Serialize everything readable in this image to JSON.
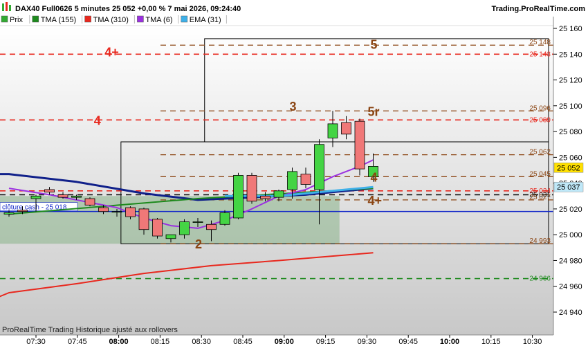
{
  "header": {
    "title": "DAX40 Full0626 5 minutes 25 052 +0,00 % 7 mai 2026, 09:24:40",
    "brand": "Trading.ProRealTime.com"
  },
  "legend": [
    {
      "label": "Prix",
      "color": "#33aa33"
    },
    {
      "label": "TMA (155)",
      "color": "#1d8a1d"
    },
    {
      "label": "TMA (310)",
      "color": "#e8281e"
    },
    {
      "label": "TMA (6)",
      "color": "#9b30e0"
    },
    {
      "label": "EMA (31)",
      "color": "#3fb0e8"
    }
  ],
  "footer": {
    "note": "ProRealTime Trading  Historique ajusté aux rollovers"
  },
  "cash_close": {
    "label": "clôture cash -  25 018",
    "value": 25018,
    "color": "#1428c8"
  },
  "colors": {
    "up": "#44d444",
    "down": "#f07878",
    "red_level": "#e8281e",
    "brown_level": "#8b4513",
    "green_level": "#1d8a1d"
  },
  "chart_data": {
    "type": "candlestick",
    "x_ticks": [
      "07:30",
      "07:45",
      "08:00",
      "08:15",
      "08:30",
      "08:45",
      "09:00",
      "09:15",
      "09:30",
      "09:45",
      "10:00",
      "10:15",
      "10:30"
    ],
    "bold_ticks": [
      "08:00",
      "09:00",
      "10:00"
    ],
    "y_ticks": [
      25160,
      25140,
      25120,
      25100,
      25080,
      25060,
      25040,
      25020,
      25000,
      24980,
      24960,
      24940
    ],
    "ylim": [
      24933,
      25166
    ],
    "candles": [
      {
        "o": 25016,
        "h": 25019,
        "l": 25014,
        "c": 25017
      },
      {
        "o": 25019,
        "h": 25022,
        "l": 25016,
        "c": 25018
      },
      {
        "o": 25028,
        "h": 25031,
        "l": 25018,
        "c": 25030
      },
      {
        "o": 25035,
        "h": 25037,
        "l": 25031,
        "c": 25033
      },
      {
        "o": 25031,
        "h": 25033,
        "l": 25028,
        "c": 25029
      },
      {
        "o": 25029,
        "h": 25031,
        "l": 25027,
        "c": 25030
      },
      {
        "o": 25028,
        "h": 25029,
        "l": 25022,
        "c": 25023
      },
      {
        "o": 25021,
        "h": 25023,
        "l": 25016,
        "c": 25018
      },
      {
        "o": 25018,
        "h": 25020,
        "l": 25014,
        "c": 25018
      },
      {
        "o": 25021,
        "h": 25022,
        "l": 25012,
        "c": 25014
      },
      {
        "o": 25020,
        "h": 25021,
        "l": 25000,
        "c": 25004
      },
      {
        "o": 25012,
        "h": 25013,
        "l": 24997,
        "c": 24999
      },
      {
        "o": 24997,
        "h": 25000,
        "l": 24994,
        "c": 25000
      },
      {
        "o": 25000,
        "h": 25012,
        "l": 24997,
        "c": 25010
      },
      {
        "o": 25010,
        "h": 25013,
        "l": 25006,
        "c": 25010
      },
      {
        "o": 25008,
        "h": 25011,
        "l": 24995,
        "c": 25004
      },
      {
        "o": 25008,
        "h": 25019,
        "l": 25007,
        "c": 25017
      },
      {
        "o": 25013,
        "h": 25048,
        "l": 25012,
        "c": 25046
      },
      {
        "o": 25046,
        "h": 25048,
        "l": 25024,
        "c": 25026
      },
      {
        "o": 25030,
        "h": 25033,
        "l": 25026,
        "c": 25028
      },
      {
        "o": 25029,
        "h": 25035,
        "l": 25026,
        "c": 25034
      },
      {
        "o": 25035,
        "h": 25052,
        "l": 25028,
        "c": 25049
      },
      {
        "o": 25047,
        "h": 25052,
        "l": 25036,
        "c": 25039
      },
      {
        "o": 25035,
        "h": 25074,
        "l": 25008,
        "c": 25070
      },
      {
        "o": 25075,
        "h": 25096,
        "l": 25068,
        "c": 25086
      },
      {
        "o": 25087,
        "h": 25092,
        "l": 25074,
        "c": 25078
      },
      {
        "o": 25088,
        "h": 25090,
        "l": 25046,
        "c": 25051
      },
      {
        "o": 25045,
        "h": 25063,
        "l": 25041,
        "c": 25053
      }
    ],
    "tma155": [
      {
        "c": 0,
        "v": 25016
      },
      {
        "c": 14,
        "v": 25028
      },
      {
        "c": 27,
        "v": 25036
      }
    ],
    "tma310": [
      {
        "c": 0,
        "v": 24955
      },
      {
        "c": 5,
        "v": 24962
      },
      {
        "c": 10,
        "v": 24970
      },
      {
        "c": 15,
        "v": 24976
      },
      {
        "c": 20,
        "v": 24980
      },
      {
        "c": 27,
        "v": 24986
      }
    ],
    "tma6": [
      {
        "c": 0,
        "v": 25036
      },
      {
        "c": 3,
        "v": 25031
      },
      {
        "c": 6,
        "v": 25025
      },
      {
        "c": 8,
        "v": 25021
      },
      {
        "c": 10,
        "v": 25013
      },
      {
        "c": 12,
        "v": 25007
      },
      {
        "c": 14,
        "v": 25005
      },
      {
        "c": 16,
        "v": 25011
      },
      {
        "c": 18,
        "v": 25020
      },
      {
        "c": 20,
        "v": 25030
      },
      {
        "c": 22,
        "v": 25035
      },
      {
        "c": 24,
        "v": 25045
      },
      {
        "c": 26,
        "v": 25053
      },
      {
        "c": 27,
        "v": 25058
      }
    ],
    "ema31": [
      {
        "c": 0,
        "v": 25047
      },
      {
        "c": 5,
        "v": 25041
      },
      {
        "c": 10,
        "v": 25032
      },
      {
        "c": 14,
        "v": 25027
      },
      {
        "c": 18,
        "v": 25029
      },
      {
        "c": 22,
        "v": 25031
      },
      {
        "c": 25,
        "v": 25034
      },
      {
        "c": 27,
        "v": 25036
      }
    ],
    "levels": [
      {
        "value": 25140,
        "color": "red",
        "label": "25 143"
      },
      {
        "value": 25089,
        "color": "red",
        "label": "25 089"
      },
      {
        "value": 25034,
        "color": "red",
        "label": "25 034"
      },
      {
        "value": 25147,
        "color": "brown",
        "label": "25 148"
      },
      {
        "value": 25096,
        "color": "brown",
        "label": "25 096"
      },
      {
        "value": 25062,
        "color": "brown",
        "label": "25 062"
      },
      {
        "value": 25045,
        "color": "brown",
        "label": "25 045"
      },
      {
        "value": 25031,
        "color": "black",
        "label": "25 031"
      },
      {
        "value": 25027,
        "color": "brown",
        "label": "25 027"
      },
      {
        "value": 24993,
        "color": "brown",
        "label": "24 993"
      },
      {
        "value": 24966,
        "color": "green",
        "label": "24 966"
      }
    ],
    "wave_labels": [
      {
        "text": "4+",
        "c": 7.5,
        "v": 25142,
        "color": "red"
      },
      {
        "text": "4",
        "c": 6.5,
        "v": 25089,
        "color": "red"
      },
      {
        "text": "5",
        "c": 27,
        "v": 25148,
        "color": "brown"
      },
      {
        "text": "5r",
        "c": 27,
        "v": 25096,
        "color": "brown"
      },
      {
        "text": "3",
        "c": 21,
        "v": 25100,
        "color": "brown"
      },
      {
        "text": "4",
        "c": 27,
        "v": 25045,
        "color": "brown"
      },
      {
        "text": "4+",
        "c": 27,
        "v": 25027,
        "color": "brown"
      },
      {
        "text": "2",
        "c": 14,
        "v": 24993,
        "color": "brown"
      }
    ],
    "price_tags": [
      {
        "label": "25 052",
        "value": 25052,
        "bg": "#ffe000"
      },
      {
        "label": "25 037",
        "value": 25037,
        "bg": "#bfe8f8"
      }
    ],
    "boxes": [
      {
        "c1": 8.3,
        "c2": 30,
        "v1": 25072,
        "v2": 24993
      },
      {
        "c1": 14.5,
        "c2": 30,
        "v1": 25152,
        "v2": 25072
      }
    ],
    "shaded_region": {
      "c1": 0,
      "c2": 24.5,
      "v_top": 25030,
      "v_bottom": 24993
    }
  }
}
